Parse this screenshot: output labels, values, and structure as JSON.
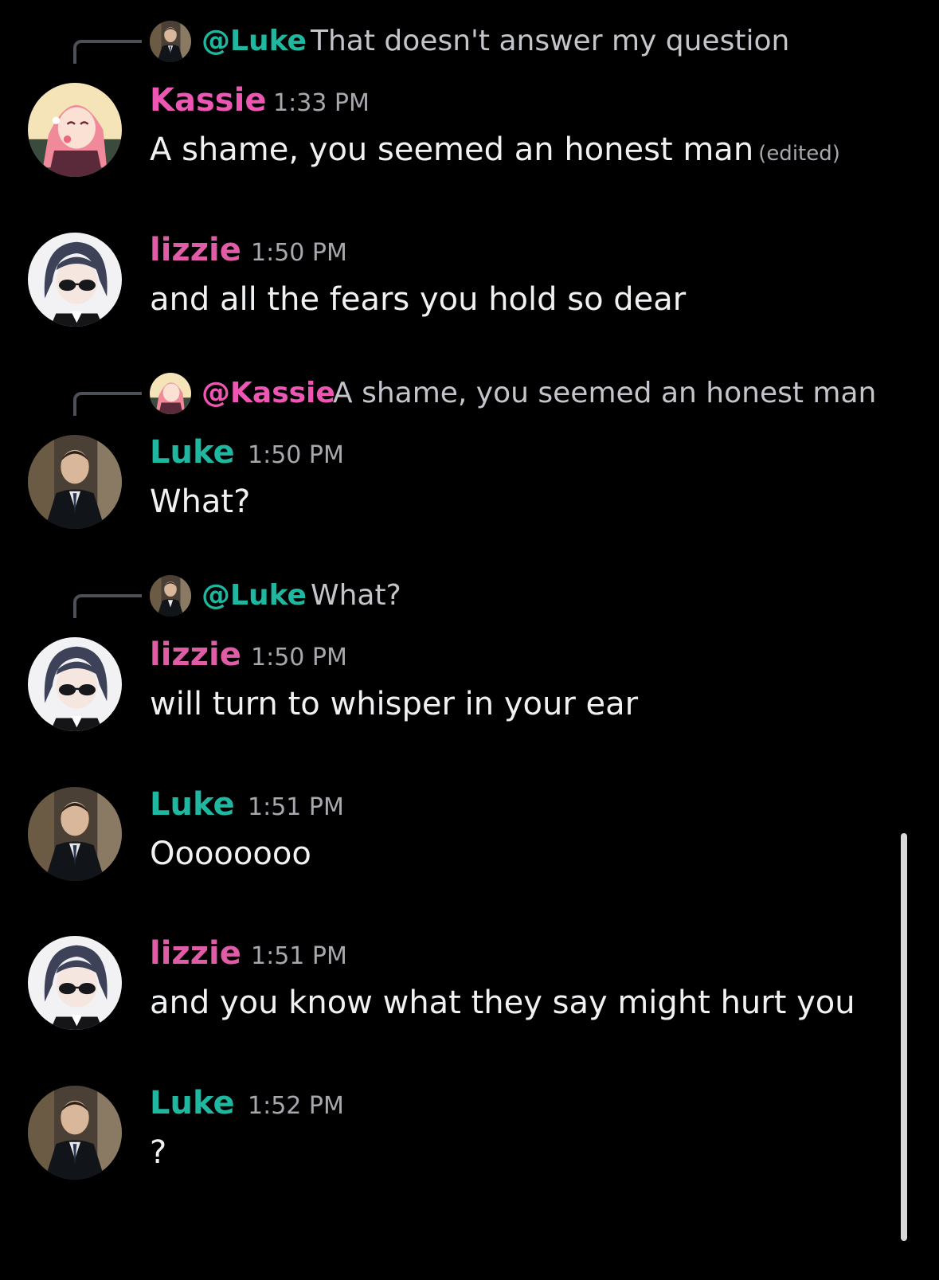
{
  "colors": {
    "background": "#000000",
    "kassie": "#ee56b4",
    "lizzie": "#e05ca6",
    "luke": "#1fb7a0",
    "timestamp": "#a7a8ae",
    "reply_text": "#c4c5cb",
    "message_text": "#f0f1f3"
  },
  "messages": [
    {
      "reply": {
        "mention": "@Luke",
        "text": "That doesn't answer my question",
        "avatar": "luke-avatar"
      },
      "author": "Kassie",
      "time": "1:33 PM",
      "text": "A shame, you seemed an honest man",
      "edited": "(edited)",
      "avatar": "kassie-avatar"
    },
    {
      "author": "lizzie",
      "time": "1:50 PM",
      "text": "and all the fears you hold so dear",
      "avatar": "lizzie-avatar"
    },
    {
      "reply": {
        "mention": "@Kassie",
        "text": "A shame, you seemed an honest man",
        "avatar": "kassie-avatar"
      },
      "author": "Luke",
      "time": "1:50 PM",
      "text": "What?",
      "avatar": "luke-avatar"
    },
    {
      "reply": {
        "mention": "@Luke",
        "text": "What?",
        "avatar": "luke-avatar"
      },
      "author": "lizzie",
      "time": "1:50 PM",
      "text": "will turn to whisper in your ear",
      "avatar": "lizzie-avatar"
    },
    {
      "author": "Luke",
      "time": "1:51 PM",
      "text": "Oooooooo",
      "avatar": "luke-avatar"
    },
    {
      "author": "lizzie",
      "time": "1:51 PM",
      "text": "and you know what they say might hurt you",
      "avatar": "lizzie-avatar"
    },
    {
      "author": "Luke",
      "time": "1:52 PM",
      "text": "?",
      "avatar": "luke-avatar"
    }
  ]
}
